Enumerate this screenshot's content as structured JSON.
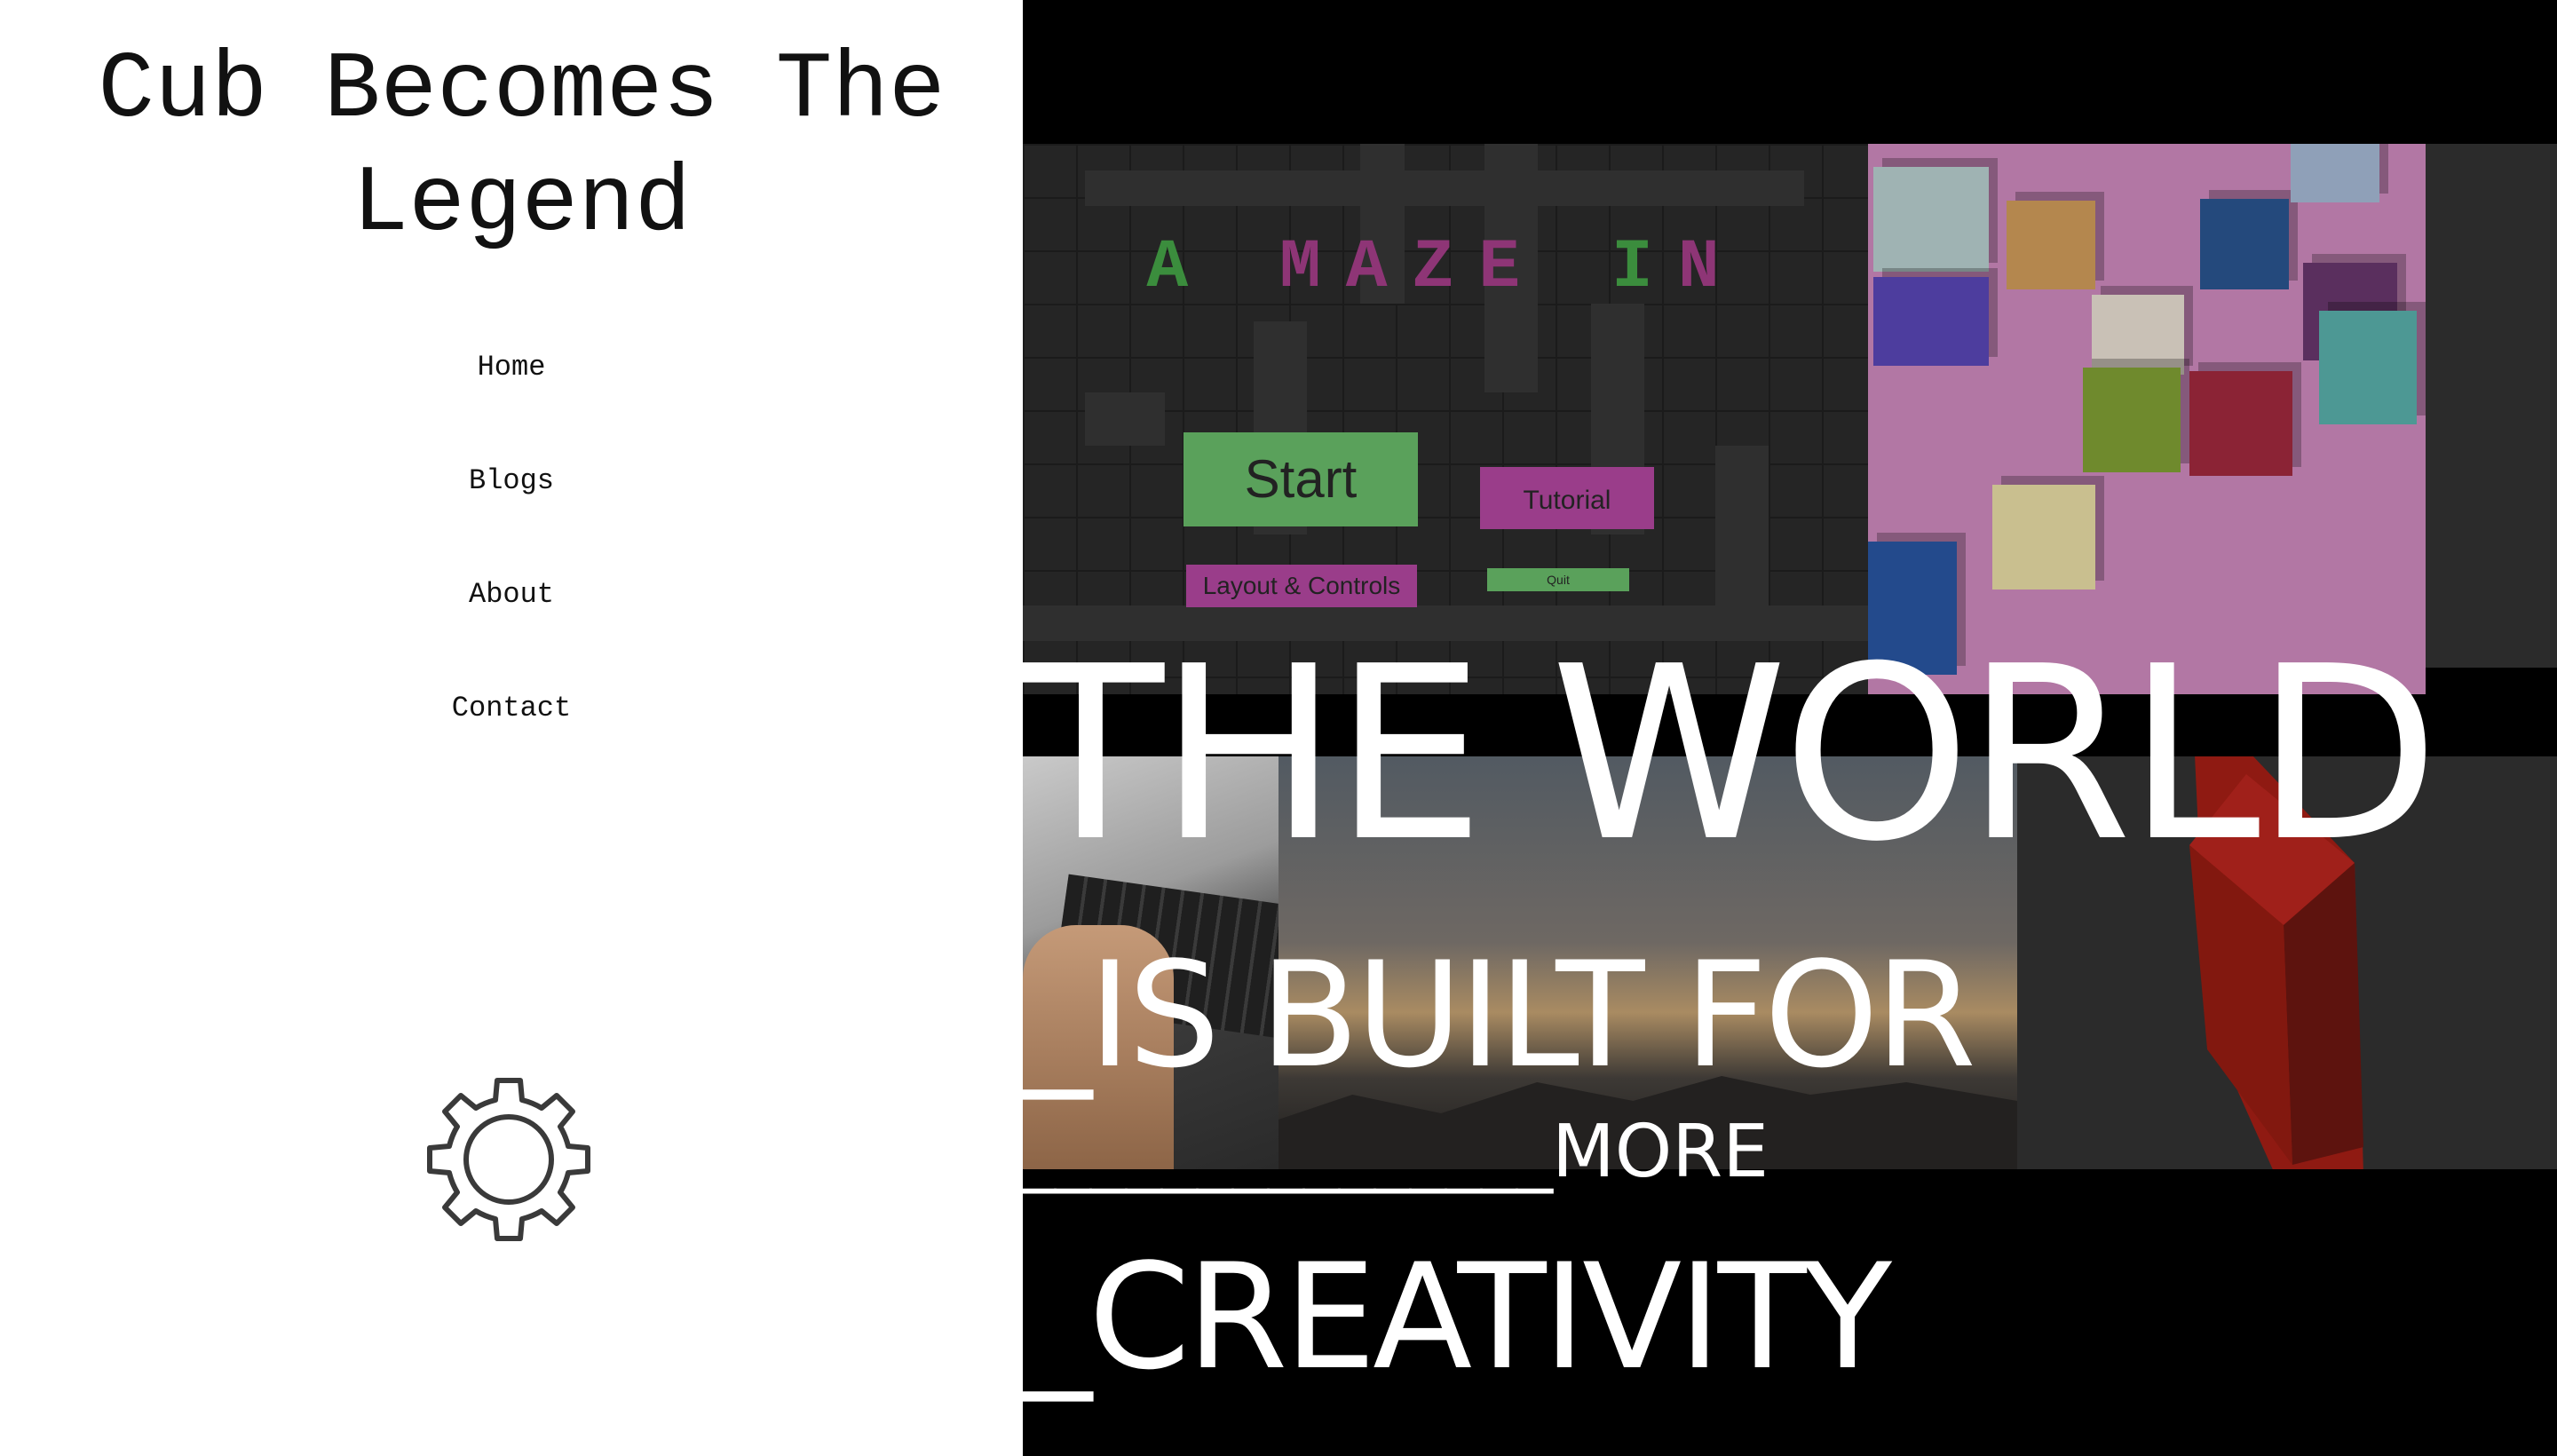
{
  "site": {
    "title": "Cub Becomes The Legend"
  },
  "nav": {
    "items": [
      {
        "label": "Home"
      },
      {
        "label": "Blogs"
      },
      {
        "label": "About"
      },
      {
        "label": "Contact"
      }
    ]
  },
  "settings": {
    "icon": "gear-icon"
  },
  "maze_screenshot": {
    "title_green_1": "A",
    "title_pink": "MAZE",
    "title_green_2": "I",
    "title_pink_2": "N",
    "start_label": "Start",
    "tutorial_label": "Tutorial",
    "layout_label": "Layout & Controls",
    "quit_label": "Quit",
    "colors": {
      "green": "#3b8d3d",
      "pink": "#8e3576",
      "start": "#5aa15b",
      "tutorial": "#9a3d8a"
    }
  },
  "hero": {
    "line1": "THE WORLD",
    "line2": "_IS BUILT FOR",
    "line3_prefix": "_______________",
    "line3_word": "MORE",
    "line4": "_CREATIVITY"
  }
}
